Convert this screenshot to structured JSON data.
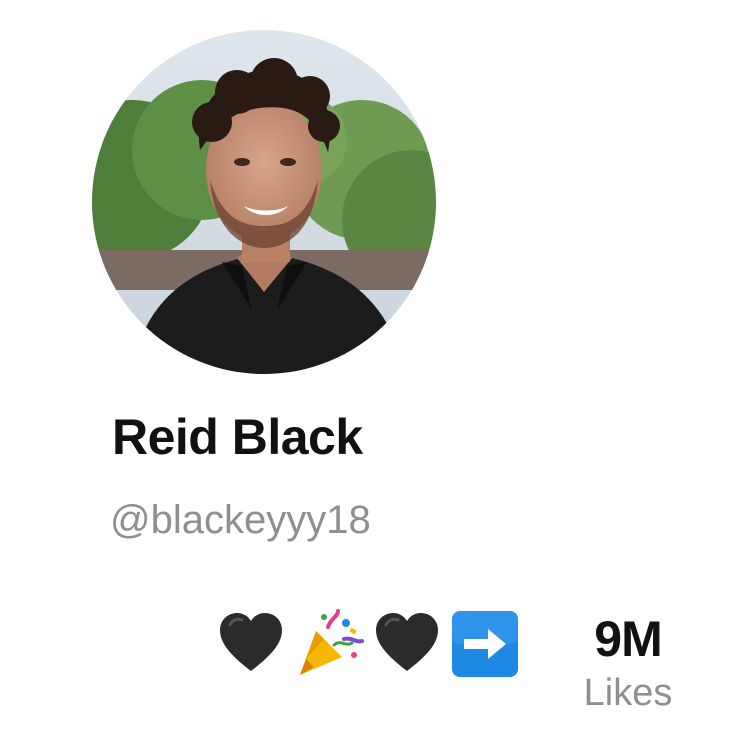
{
  "profile": {
    "display_name": "Reid Black",
    "handle": "@blackeyyy18",
    "avatar_icon": "profile-photo",
    "bio_emojis": [
      "black-heart-icon",
      "party-popper-icon",
      "black-heart-icon",
      "right-arrow-icon"
    ]
  },
  "stats": {
    "likes": {
      "count": "9M",
      "label": "Likes"
    }
  },
  "colors": {
    "name_text": "#111111",
    "secondary_text": "#8f8f8f",
    "arrow_emoji_bg": "#1e88e5",
    "heart": "#2b2b2b"
  }
}
